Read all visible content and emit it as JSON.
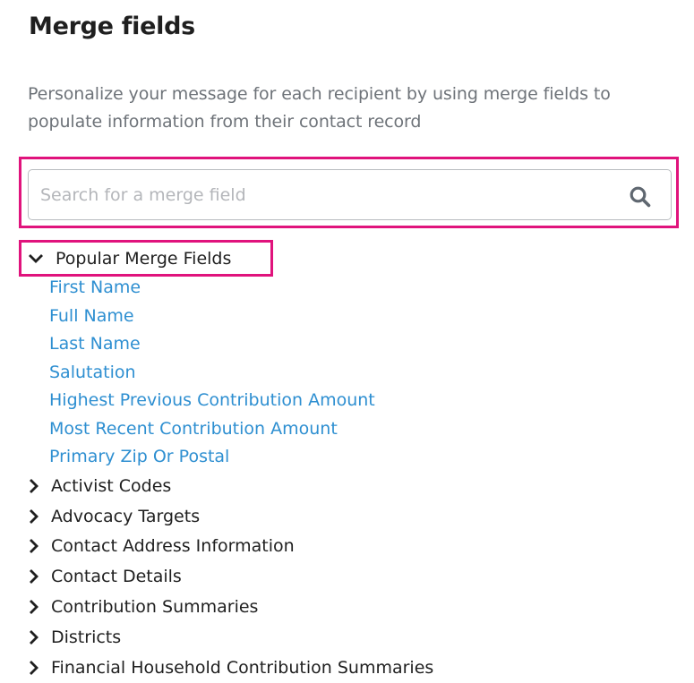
{
  "header": {
    "title": "Merge fields",
    "description": "Personalize your message for each recipient by using merge fields to populate information from their contact record"
  },
  "search": {
    "placeholder": "Search for a merge field",
    "value": "",
    "icon": "search-icon"
  },
  "popular_section": {
    "label": "Popular Merge Fields",
    "expanded": true,
    "icon": "chevron-down-icon",
    "fields": [
      {
        "label": "First Name"
      },
      {
        "label": "Full Name"
      },
      {
        "label": "Last Name"
      },
      {
        "label": "Salutation"
      },
      {
        "label": "Highest Previous Contribution Amount"
      },
      {
        "label": "Most Recent Contribution Amount"
      },
      {
        "label": "Primary Zip Or Postal"
      }
    ]
  },
  "categories": [
    {
      "label": "Activist Codes",
      "icon": "chevron-right-icon"
    },
    {
      "label": "Advocacy Targets",
      "icon": "chevron-right-icon"
    },
    {
      "label": "Contact Address Information",
      "icon": "chevron-right-icon"
    },
    {
      "label": "Contact Details",
      "icon": "chevron-right-icon"
    },
    {
      "label": "Contribution Summaries",
      "icon": "chevron-right-icon"
    },
    {
      "label": "Districts",
      "icon": "chevron-right-icon"
    },
    {
      "label": "Financial Household Contribution Summaries",
      "icon": "chevron-right-icon"
    }
  ],
  "colors": {
    "highlight": "#e0137c",
    "link": "#2e8fd1",
    "muted_text": "#6e7379",
    "text": "#1f1f1f"
  }
}
